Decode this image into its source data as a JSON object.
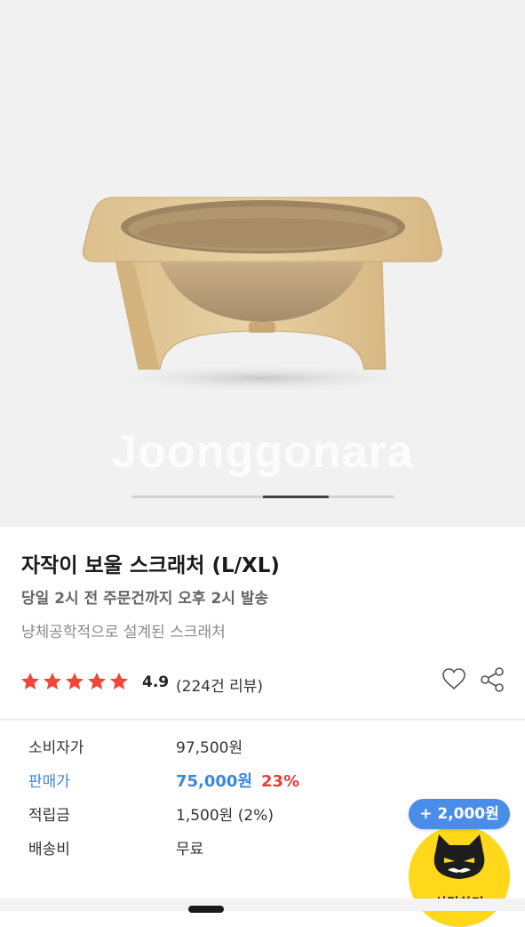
{
  "hero": {
    "image_alt": "wooden bowl cat scratcher",
    "watermark": "Joonggonara",
    "pager": {
      "current": 3,
      "total": 4
    }
  },
  "product": {
    "title": "자작이 보울 스크래처 (L/XL)",
    "shipping_note": "당일 2시 전 주문건까지 오후 2시 발송",
    "subtitle": "냥체공학적으로 설계된 스크래처",
    "rating": "4.9",
    "review_count": "(224건 리뷰)",
    "stars": 5,
    "star_color": "#f0463a"
  },
  "prices": [
    {
      "label": "소비자가",
      "value": "97,500원"
    },
    {
      "label": "판매가",
      "value": "75,000원",
      "discount": "23%"
    },
    {
      "label": "적립금",
      "value": "1,500원 (2%)"
    },
    {
      "label": "배송비",
      "value": "무료"
    }
  ],
  "actions": {
    "wishlist_icon": "heart-icon",
    "share_icon": "share-icon"
  },
  "chat": {
    "points_badge": "+ 2,000원",
    "label": "상담하기",
    "badge_color": "#4a8de8",
    "button_color": "#ffd81c"
  },
  "colors": {
    "sale_blue": "#3d87d8",
    "discount_red": "#e53d3d"
  }
}
